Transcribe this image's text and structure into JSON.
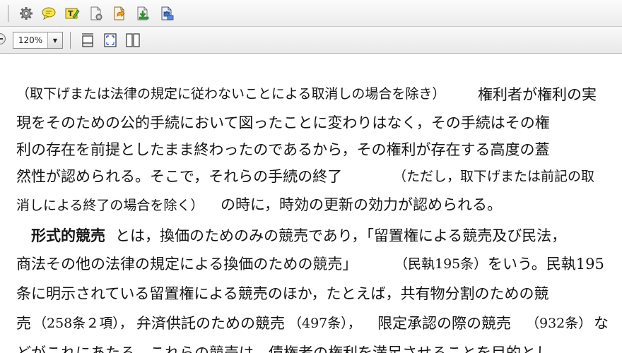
{
  "toolbar": {
    "icons": [
      "gear-icon",
      "comment-icon",
      "highlight-text-icon",
      "document-settings-icon",
      "document-export-icon",
      "download-icon",
      "document-upload-icon"
    ]
  },
  "view_toolbar": {
    "zoom_value": "120%",
    "zoom_dropdown_arrow": "▼",
    "view_icons": [
      "single-page-icon",
      "fit-page-icon",
      "two-page-icon"
    ]
  },
  "document": {
    "lines": [
      "（取下げまたは法律の規定に従わないことによる取消しの場合を除き）",
      "権利者が権利の実",
      "現をそのための公的手続において図ったことに変わりはなく，その手続はその権",
      "利の存在を前提としたまま終わったのであるから，その権利が存在する高度の蓋",
      "然性が認められる。そこで，それらの手続の終了",
      "（ただし，取下げまたは前記の取",
      "消しによる終了の場合を除く）",
      "の時に，時効の更新の効力が認められる。",
      "形式的競売",
      "とは，換価のためのみの競売であり，「留置権による競売及び民法，",
      "商法その他の法律の規定による換価のための競売」",
      "（民執195条）",
      "をいう。民執195",
      "条に明示されている留置権による競売のほか，たとえば，共有物分割のための競",
      "売",
      "（258条２項），",
      "弁済供託のための競売",
      "（497条），",
      "限定承認の際の競売",
      "（932条）",
      "な",
      "どがこれにあたる。これらの競売は，債権者の権利を満足させることを目的とし"
    ]
  }
}
